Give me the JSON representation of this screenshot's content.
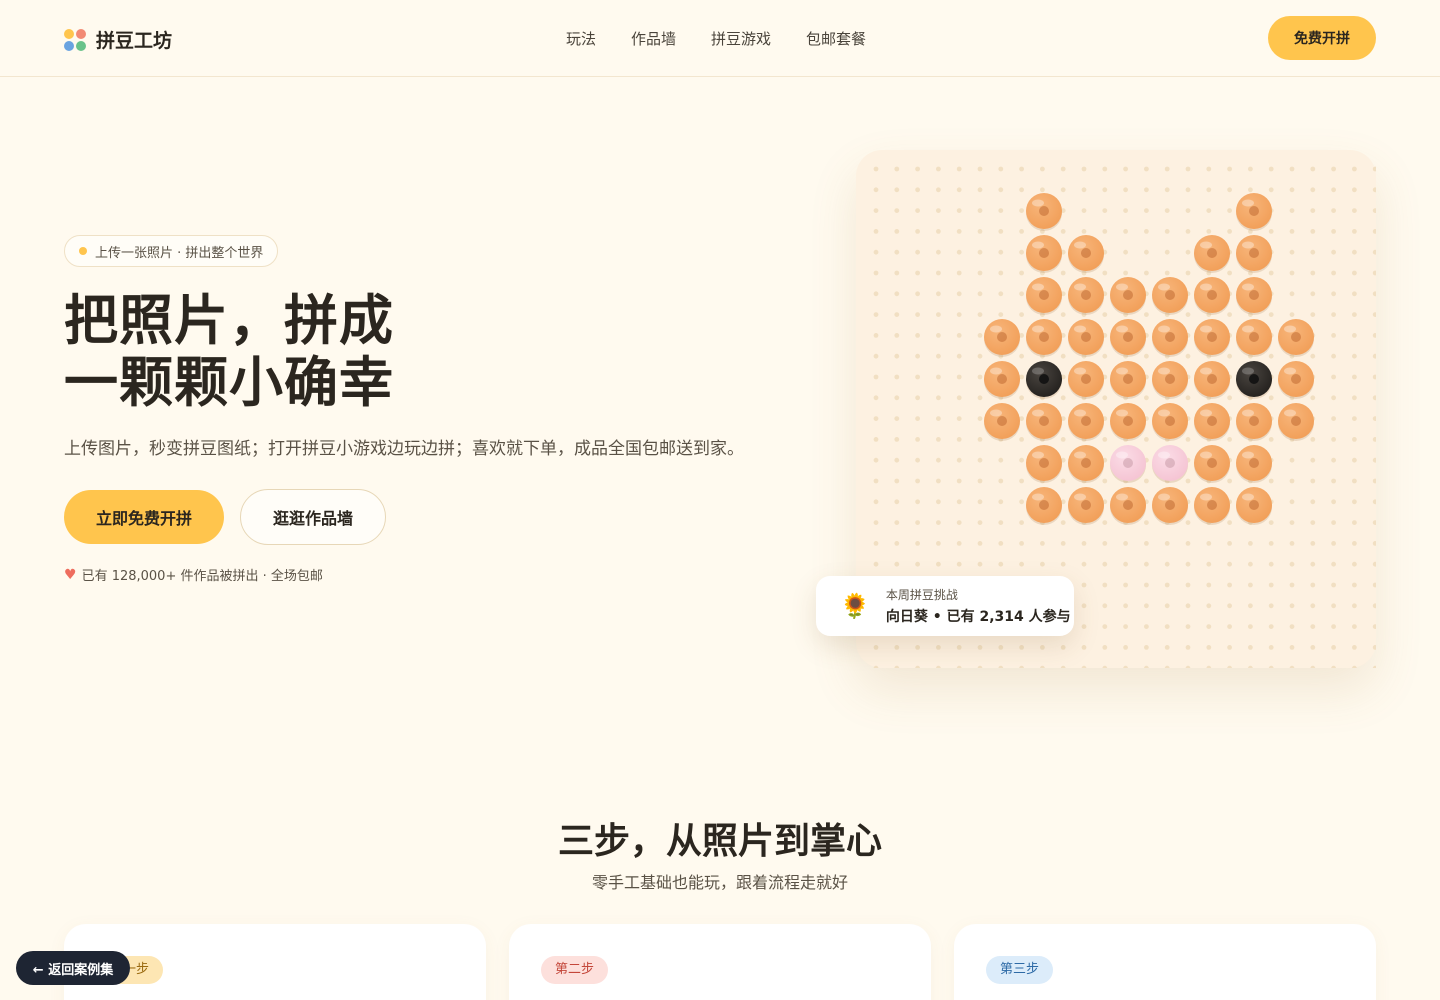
{
  "header": {
    "brand_name": "拼豆工坊",
    "brand_dot_colors": [
      "#ffc54d",
      "#f28a74",
      "#6aa3e0",
      "#69c28a"
    ],
    "nav": [
      "玩法",
      "作品墙",
      "拼豆游戏",
      "包邮套餐"
    ],
    "cta": "免费开拼"
  },
  "hero": {
    "badge": "上传一张照片 · 拼出整个世界",
    "title_line1": "把照片，拼成",
    "title_line2": "一颗颗小确幸",
    "subtitle": "上传图片，秒变拼豆图纸；打开拼豆小游戏边玩边拼；喜欢就下单，成品全国包邮送到家。",
    "primary_button": "立即免费开拼",
    "secondary_button": "逛逛作品墙",
    "social_proof": "已有 128,000+ 件作品被拼出 · 全场包邮"
  },
  "pegboard": {
    "pattern": [
      "...o....o..",
      "...oo..oo..",
      "...oooooo..",
      "..oooooooo.",
      "..oBooooBo.",
      "..oooooooo.",
      "...ooppoo..",
      "...oooooo.."
    ],
    "colors": {
      "o": "#f2a05a",
      "B": "#262320",
      "p": "#f5c5d4",
      "peg": "#f1dfc2",
      "board": "#fdf1e1"
    }
  },
  "challenge": {
    "icon": "sunflower-icon",
    "title": "本周拼豆挑战",
    "detail": "向日葵 • 已有 2,314 人参与"
  },
  "steps": {
    "title": "三步，从照片到掌心",
    "subtitle": "零手工基础也能玩，跟着流程走就好",
    "items": [
      {
        "badge": "第一步",
        "badge_bg": "#fde6b3",
        "badge_color": "#9a6a10"
      },
      {
        "badge": "第二步",
        "badge_bg": "#fde0dc",
        "badge_color": "#c4473a"
      },
      {
        "badge": "第三步",
        "badge_bg": "#dcecfa",
        "badge_color": "#2d6aa6"
      }
    ]
  },
  "back_button": "← 返回案例集"
}
